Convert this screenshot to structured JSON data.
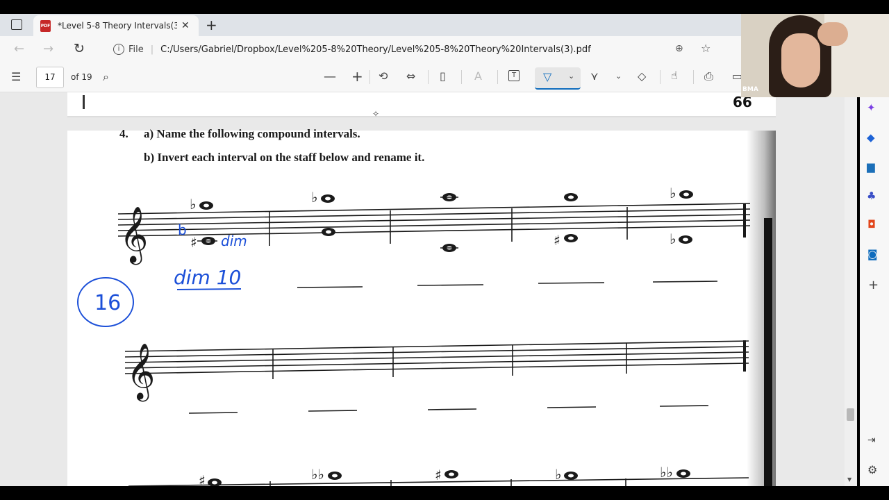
{
  "browser": {
    "tab_title": "*Level 5-8 Theory Intervals(3).pd",
    "tab_pdf_badge": "PDF",
    "file_label": "File",
    "url": "C:/Users/Gabriel/Dropbox/Level%205-8%20Theory/Level%205-8%20Theory%20Intervals(3).pdf"
  },
  "pdf_toolbar": {
    "page_number": "17",
    "page_total": "of 19"
  },
  "document": {
    "question_number": "4.",
    "instruction_a": "a) Name the following compound intervals.",
    "instruction_b": "b) Invert each interval on the staff below and rename it.",
    "handwriting": {
      "circled_number": "16",
      "answer_1": "dim 10",
      "note_annotation": "dim",
      "flat_mark": "b"
    },
    "accidentals": {
      "flat": "♭",
      "sharp": "♯",
      "double_flat": "♭♭"
    }
  },
  "video": {
    "participant_label": "BMA"
  },
  "colors": {
    "ink": "#1a1a1a",
    "handwriting": "#1b4fd8",
    "accent": "#0f6cbd"
  }
}
